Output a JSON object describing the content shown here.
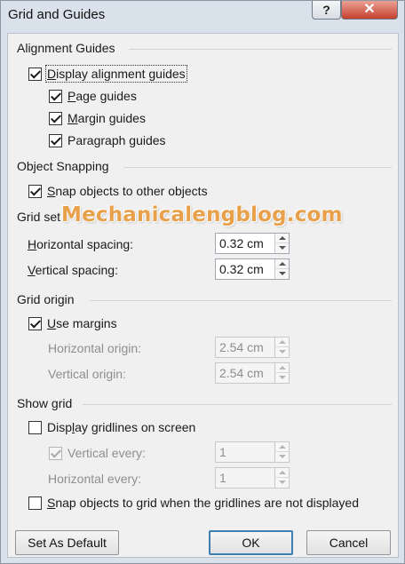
{
  "window": {
    "title": "Grid and Guides",
    "help_label": "?",
    "close_label": "✕"
  },
  "alignment_guides": {
    "header": "Alignment Guides",
    "display_label_u": "D",
    "display_label_rest": "isplay alignment guides",
    "display_checked": true,
    "page_u": "P",
    "page_rest": "age guides",
    "page_checked": true,
    "margin_u": "M",
    "margin_rest": "argin guides",
    "margin_checked": true,
    "paragraph_pre": "Para",
    "paragraph_u": "g",
    "paragraph_rest": "raph guides",
    "paragraph_checked": true
  },
  "object_snapping": {
    "header": "Object Snapping",
    "snap_u": "S",
    "snap_rest": "nap objects to other objects",
    "snap_checked": true
  },
  "grid_settings": {
    "header": "Grid set",
    "horizontal_u": "H",
    "horizontal_rest": "orizontal spacing:",
    "horizontal_value": "0.32 cm",
    "vertical_u": "V",
    "vertical_rest": "ertical spacing:",
    "vertical_value": "0.32 cm"
  },
  "grid_origin": {
    "header": "Grid origin",
    "use_margins_u": "U",
    "use_margins_rest": "se margins",
    "use_margins_checked": true,
    "h_origin_label": "Horizontal origin:",
    "h_origin_value": "2.54 cm",
    "v_origin_label": "Vertical origin:",
    "v_origin_value": "2.54 cm"
  },
  "show_grid": {
    "header": "Show grid",
    "display_pre": "Disp",
    "display_u": "l",
    "display_rest": "ay gridlines on screen",
    "display_checked": false,
    "vertical_every_label": "Vertical every:",
    "vertical_every_checked": true,
    "vertical_every_value": "1",
    "horizontal_every_label": "Horizontal every:",
    "horizontal_every_value": "1",
    "snap_u": "S",
    "snap_rest": "nap objects to grid when the gridlines are not displayed",
    "snap_checked": false
  },
  "buttons": {
    "set_default": "Set As Default",
    "ok": "OK",
    "cancel": "Cancel"
  },
  "watermark": "Mechanicalengblog.com",
  "colors": {
    "close_button": "#c7402e",
    "default_button_border": "#3c7fb1",
    "watermark": "#e8a04a"
  }
}
